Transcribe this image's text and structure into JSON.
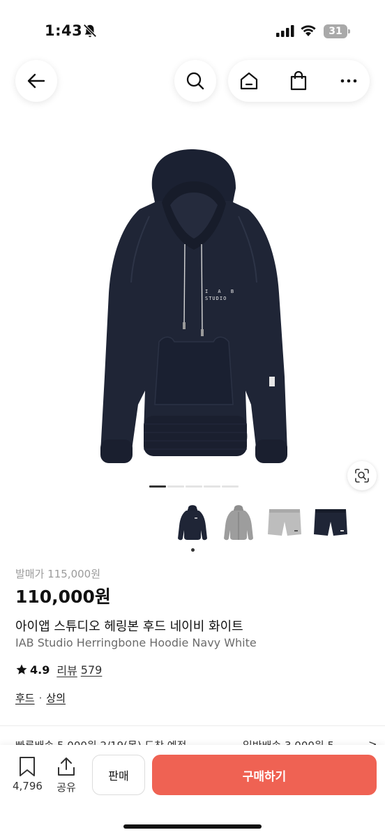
{
  "status_bar": {
    "time": "1:43",
    "battery": "31",
    "icons": [
      "bell-off-icon",
      "cellular-signal-icon",
      "wifi-icon",
      "battery-icon"
    ]
  },
  "nav": {
    "icons": [
      "back-arrow-icon",
      "search-icon",
      "home-icon",
      "shopping-bag-icon",
      "more-icon"
    ]
  },
  "product": {
    "image_print": {
      "line1": "I A B",
      "line2": "STUDIO"
    },
    "pager_count": 5,
    "pager_active": 1,
    "thumbnails": [
      "navy-hoodie-thumbnail",
      "gray-hoodie-thumbnail",
      "gray-shorts-thumbnail",
      "navy-shorts-thumbnail"
    ],
    "original_price": "발매가 115,000원",
    "price": "110,000원",
    "name_kr": "아이앱 스튜디오 헤링본 후드 네이비 화이트",
    "name_en": "IAB Studio Herringbone Hoodie Navy White",
    "rating": "4.9",
    "review_label": "리뷰",
    "review_count": "579",
    "categories": [
      "후드",
      "상의"
    ]
  },
  "delivery": {
    "fast": "빠른배송 5,000원 2/19(목) 도착 예정",
    "normal": "일반배송 3,000원 5",
    "chevron": ">"
  },
  "bottom_bar": {
    "wishlist_count": "4,796",
    "share_label": "공유",
    "sell_label": "판매",
    "buy_label": "구매하기"
  },
  "colors": {
    "buy_button": "#ef6253",
    "hoodie_navy": "#1f2536",
    "text_muted": "#9b9b9b"
  }
}
